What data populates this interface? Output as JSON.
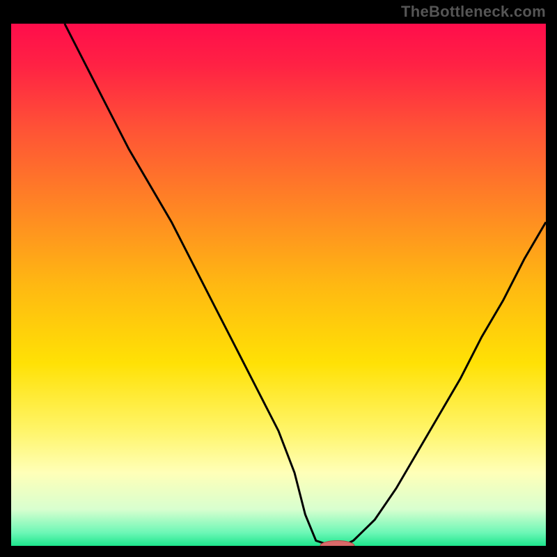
{
  "watermark": "TheBottleneck.com",
  "colors": {
    "frame": "#000000",
    "watermark": "#555555",
    "curve": "#000000",
    "marker_fill": "#d96a6a",
    "marker_stroke": "#b24444",
    "gradient_stops": [
      {
        "offset": 0.0,
        "color": "#ff0d4b"
      },
      {
        "offset": 0.08,
        "color": "#ff2244"
      },
      {
        "offset": 0.2,
        "color": "#ff5236"
      },
      {
        "offset": 0.35,
        "color": "#ff8524"
      },
      {
        "offset": 0.5,
        "color": "#ffb812"
      },
      {
        "offset": 0.65,
        "color": "#ffe105"
      },
      {
        "offset": 0.78,
        "color": "#fff56a"
      },
      {
        "offset": 0.86,
        "color": "#ffffb8"
      },
      {
        "offset": 0.93,
        "color": "#d8ffcf"
      },
      {
        "offset": 0.975,
        "color": "#6cf7b6"
      },
      {
        "offset": 1.0,
        "color": "#1de58c"
      }
    ]
  },
  "chart_data": {
    "type": "line",
    "title": "",
    "xlabel": "",
    "ylabel": "",
    "xlim": [
      0,
      100
    ],
    "ylim": [
      0,
      100
    ],
    "grid": false,
    "legend": false,
    "series": [
      {
        "name": "bottleneck-curve",
        "x": [
          10,
          14,
          18,
          22,
          26,
          30,
          34,
          38,
          42,
          46,
          50,
          53,
          55,
          57,
          60,
          62,
          64,
          68,
          72,
          76,
          80,
          84,
          88,
          92,
          96,
          100
        ],
        "values": [
          100,
          92,
          84,
          76,
          69,
          62,
          54,
          46,
          38,
          30,
          22,
          14,
          6,
          1,
          0,
          0,
          1,
          5,
          11,
          18,
          25,
          32,
          40,
          47,
          55,
          62
        ]
      }
    ],
    "marker": {
      "x": 61,
      "y": 0,
      "rx": 3.2,
      "ry": 1.0
    }
  }
}
